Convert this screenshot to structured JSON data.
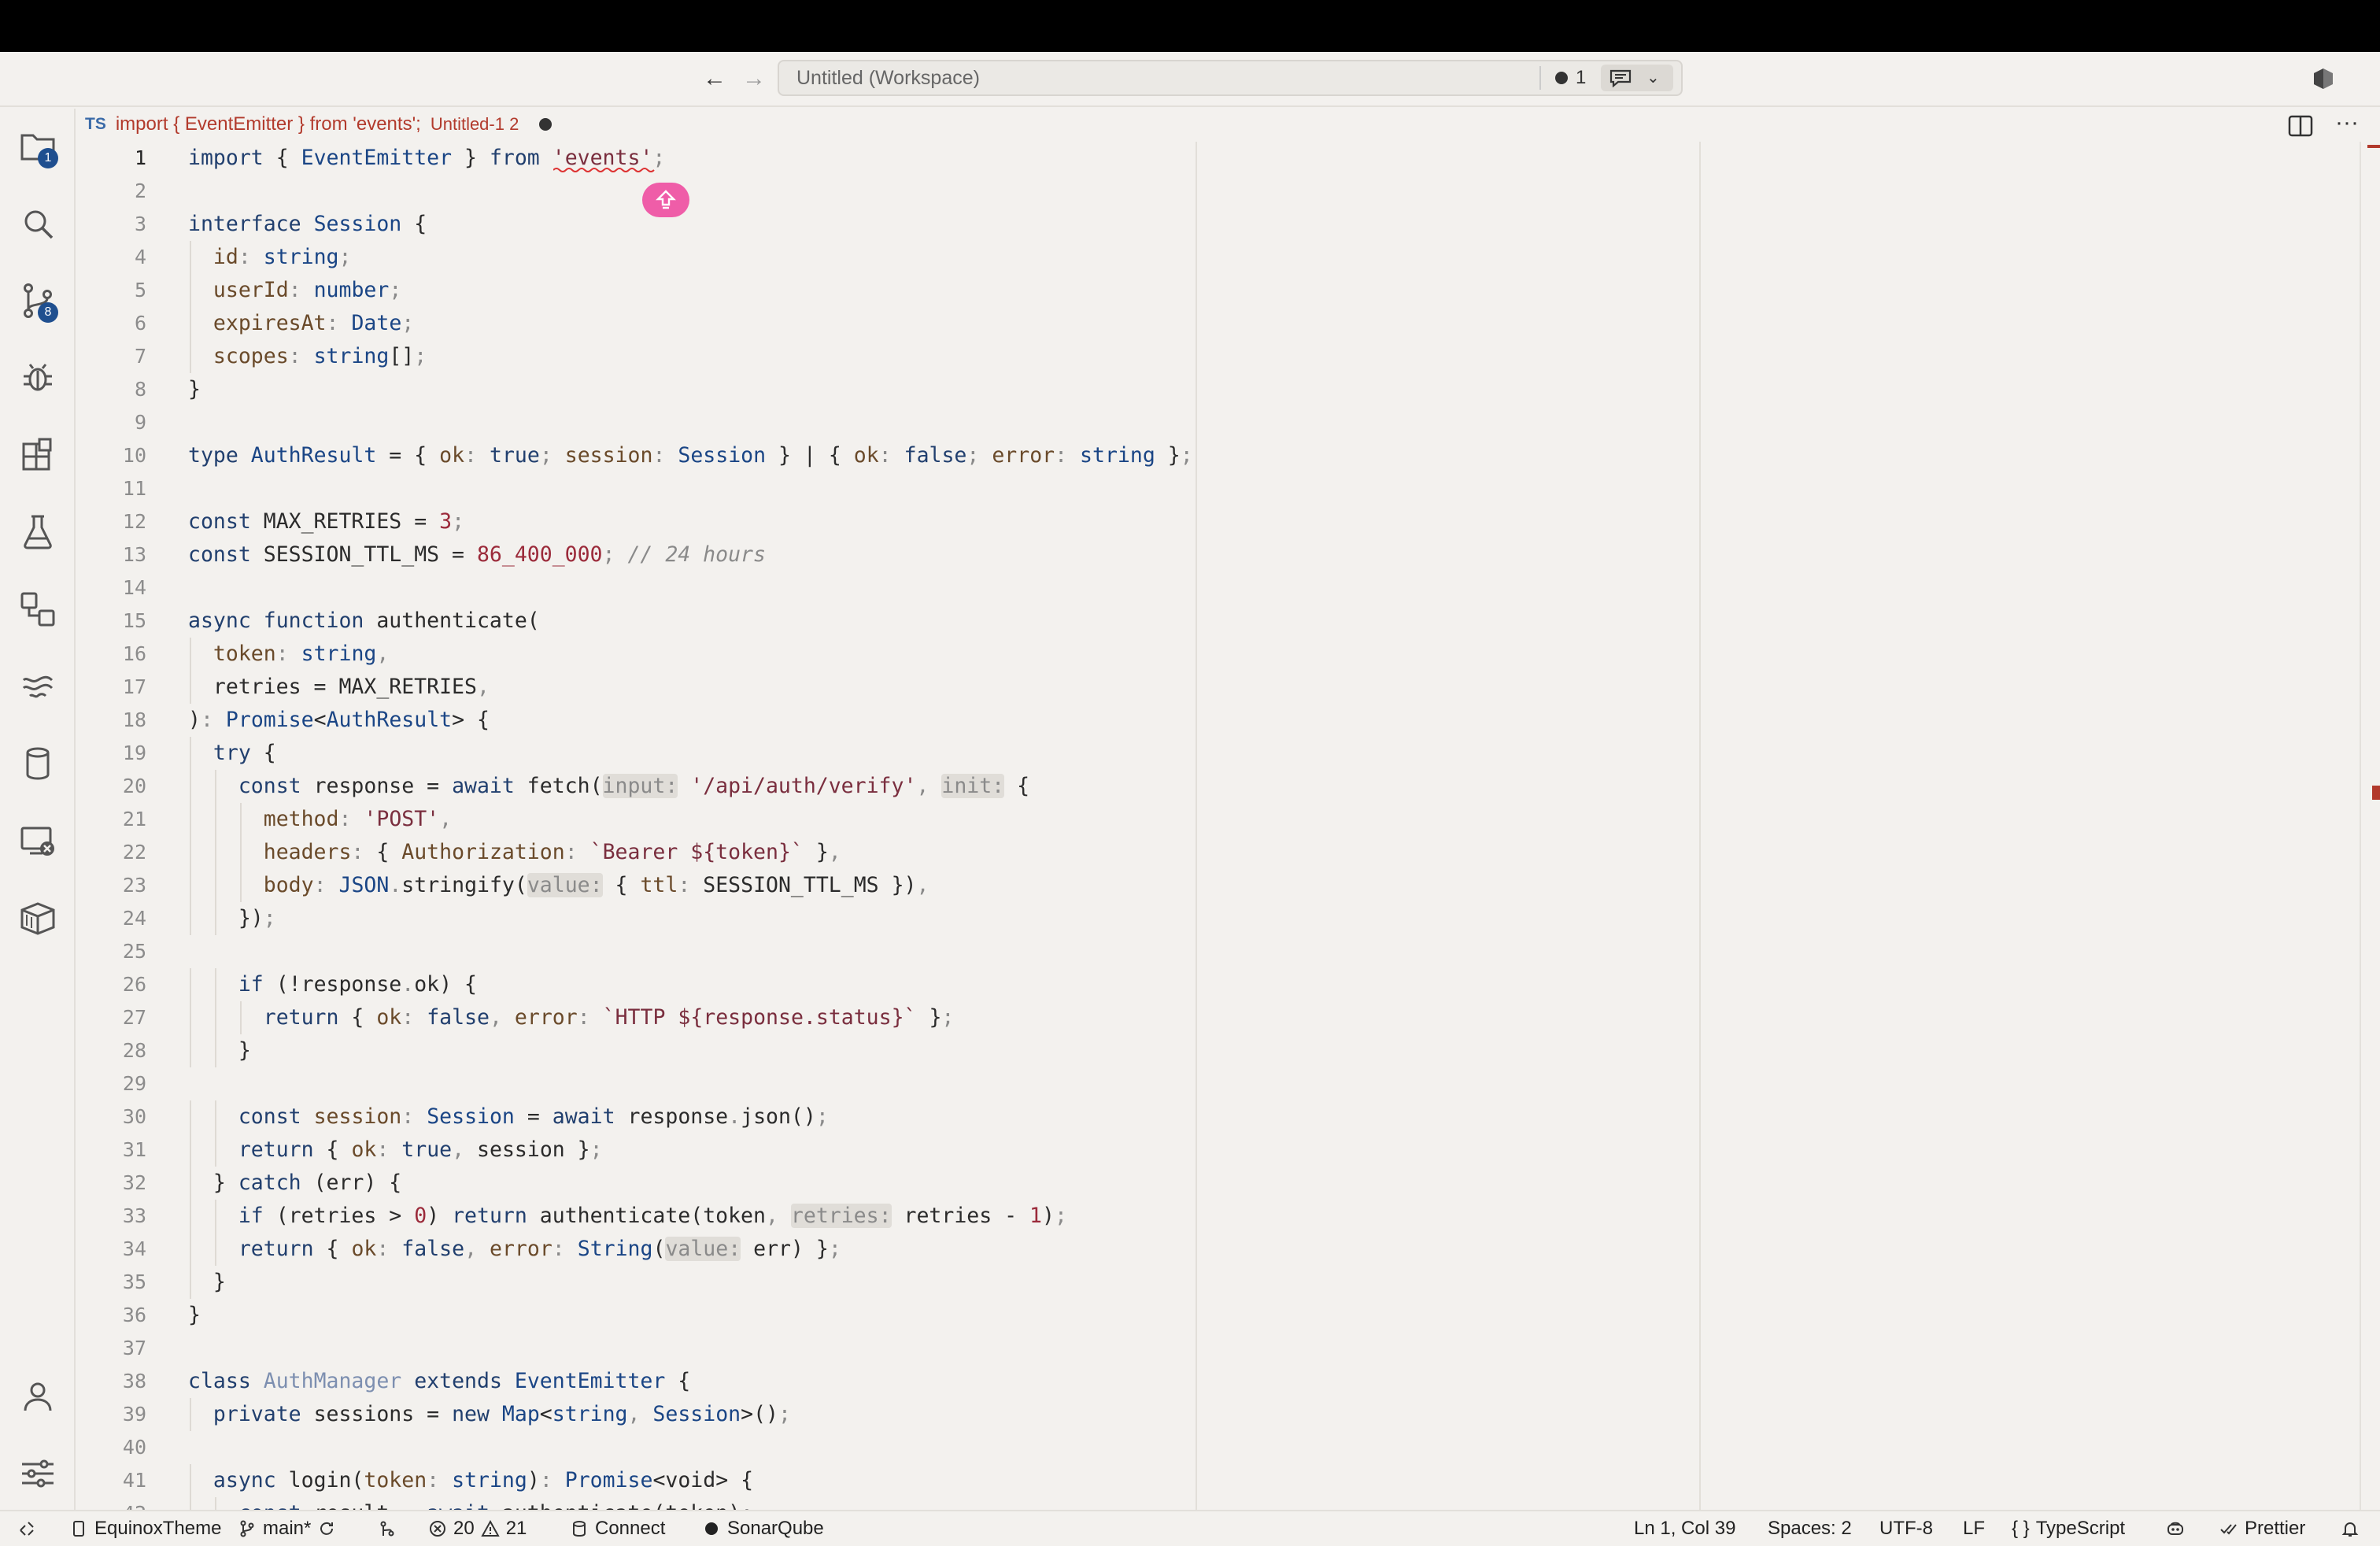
{
  "titlebar": {
    "back_icon": "arrow-left-icon",
    "forward_icon": "arrow-right-icon",
    "back_glyph": "←",
    "forward_glyph": "→",
    "command_center_title": "Untitled (Workspace)",
    "problems_count": "1",
    "chat_chevron": "⌄"
  },
  "activity_bar": {
    "items": [
      {
        "name": "explorer",
        "icon": "files-icon",
        "badge": "1"
      },
      {
        "name": "search",
        "icon": "search-icon",
        "badge": ""
      },
      {
        "name": "source-control",
        "icon": "source-control-icon",
        "badge": "8"
      },
      {
        "name": "run-debug",
        "icon": "bug-icon",
        "badge": ""
      },
      {
        "name": "extensions",
        "icon": "extensions-icon",
        "badge": ""
      },
      {
        "name": "testing",
        "icon": "beaker-icon",
        "badge": ""
      },
      {
        "name": "remote-explorer",
        "icon": "remote-explorer-icon",
        "badge": ""
      },
      {
        "name": "timeline",
        "icon": "wave-icon",
        "badge": ""
      },
      {
        "name": "database",
        "icon": "database-icon",
        "badge": ""
      },
      {
        "name": "remote-window",
        "icon": "remote-window-icon",
        "badge": ""
      },
      {
        "name": "packages",
        "icon": "package-icon",
        "badge": ""
      }
    ],
    "bottom": [
      {
        "name": "accounts",
        "icon": "account-icon"
      },
      {
        "name": "manage",
        "icon": "settings-sliders-icon"
      }
    ]
  },
  "tab": {
    "lang_badge": "TS",
    "name": "import { EventEmitter } from 'events';",
    "description": "Untitled-1 2"
  },
  "editor": {
    "more_actions": "···",
    "active_line": 1,
    "line_numbers": [
      "1",
      "2",
      "3",
      "4",
      "5",
      "6",
      "7",
      "8",
      "9",
      "10",
      "11",
      "12",
      "13",
      "14",
      "15",
      "16",
      "17",
      "18",
      "19",
      "20",
      "21",
      "22",
      "23",
      "24",
      "25",
      "26",
      "27",
      "28",
      "29",
      "30",
      "31",
      "32",
      "33",
      "34",
      "35",
      "36",
      "37",
      "38",
      "39",
      "40",
      "41"
    ],
    "lines": [
      "import { EventEmitter } from 'events';",
      "",
      "interface Session {",
      "  id: string;",
      "  userId: number;",
      "  expiresAt: Date;",
      "  scopes: string[];",
      "}",
      "",
      "type AuthResult = { ok: true; session: Session } | { ok: false; error: string };",
      "",
      "const MAX_RETRIES = 3;",
      "const SESSION_TTL_MS = 86_400_000; // 24 hours",
      "",
      "async function authenticate(",
      "  token: string,",
      "  retries = MAX_RETRIES,",
      "): Promise<AuthResult> {",
      "  try {",
      "    const response = await fetch(input: '/api/auth/verify', init: {",
      "      method: 'POST',",
      "      headers: { Authorization: `Bearer ${token}` },",
      "      body: JSON.stringify(value: { ttl: SESSION_TTL_MS }),",
      "    });",
      "",
      "    if (!response.ok) {",
      "      return { ok: false, error: `HTTP ${response.status}` };",
      "    }",
      "",
      "    const session: Session = await response.json();",
      "    return { ok: true, session };",
      "  } catch (err) {",
      "    if (retries > 0) return authenticate(token, retries: retries - 1);",
      "    return { ok: false, error: String(value: err) };",
      "  }",
      "}",
      "",
      "class AuthManager extends EventEmitter {",
      "  private sessions = new Map<string, Session>();",
      "",
      "  async login(token: string): Promise<void> {"
    ],
    "partial_last_line": "    const result = await authenticate(token);",
    "lightbulb_icon": "sparkle-lightbulb-icon"
  },
  "statusbar": {
    "remote_icon": "remote-icon",
    "profile": "EquinoxTheme",
    "branch": "main*",
    "sync_icon": "sync-icon",
    "errors": "20",
    "warnings": "21",
    "connect": "Connect",
    "sonar": "SonarQube",
    "cursor": "Ln 1, Col 39",
    "indent": "Spaces: 2",
    "encoding": "UTF-8",
    "eol": "LF",
    "language": "TypeScript",
    "copilot_icon": "copilot-icon",
    "prettier": "Prettier",
    "bell_icon": "bell-icon"
  },
  "colors": {
    "background": "#f3f1ee",
    "keyword": "#213f6e",
    "string": "#7a2e3e",
    "number": "#9b2a3a",
    "badge": "#1f4f8f",
    "error": "#b23a2c",
    "lightbulb": "#ef5da8"
  }
}
